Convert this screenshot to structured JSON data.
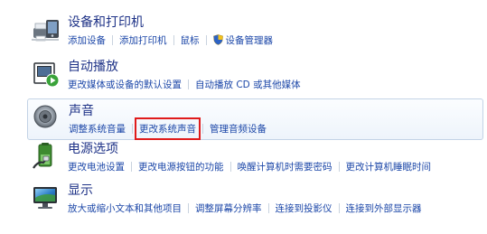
{
  "categories": [
    {
      "title": "设备和打印机",
      "icon": "devices-printers-icon",
      "links": [
        "添加设备",
        "添加打印机",
        "鼠标",
        "设备管理器"
      ]
    },
    {
      "title": "自动播放",
      "icon": "autoplay-icon",
      "links": [
        "更改媒体或设备的默认设置",
        "自动播放 CD 或其他媒体"
      ]
    },
    {
      "title": "声音",
      "icon": "speaker-icon",
      "links": [
        "调整系统音量",
        "更改系统声音",
        "管理音频设备"
      ],
      "highlighted_link": "更改系统声音"
    },
    {
      "title": "电源选项",
      "icon": "power-options-icon",
      "links": [
        "更改电池设置",
        "更改电源按钮的功能",
        "唤醒计算机时需要密码",
        "更改计算机睡眠时间"
      ]
    },
    {
      "title": "显示",
      "icon": "display-icon",
      "links": [
        "放大或缩小文本和其他项目",
        "调整屏幕分辨率",
        "连接到投影仪",
        "连接到外部显示器"
      ]
    }
  ],
  "colors": {
    "title": "#1e3287",
    "link": "#1c47a8",
    "highlight_box": "#e01b1b"
  }
}
